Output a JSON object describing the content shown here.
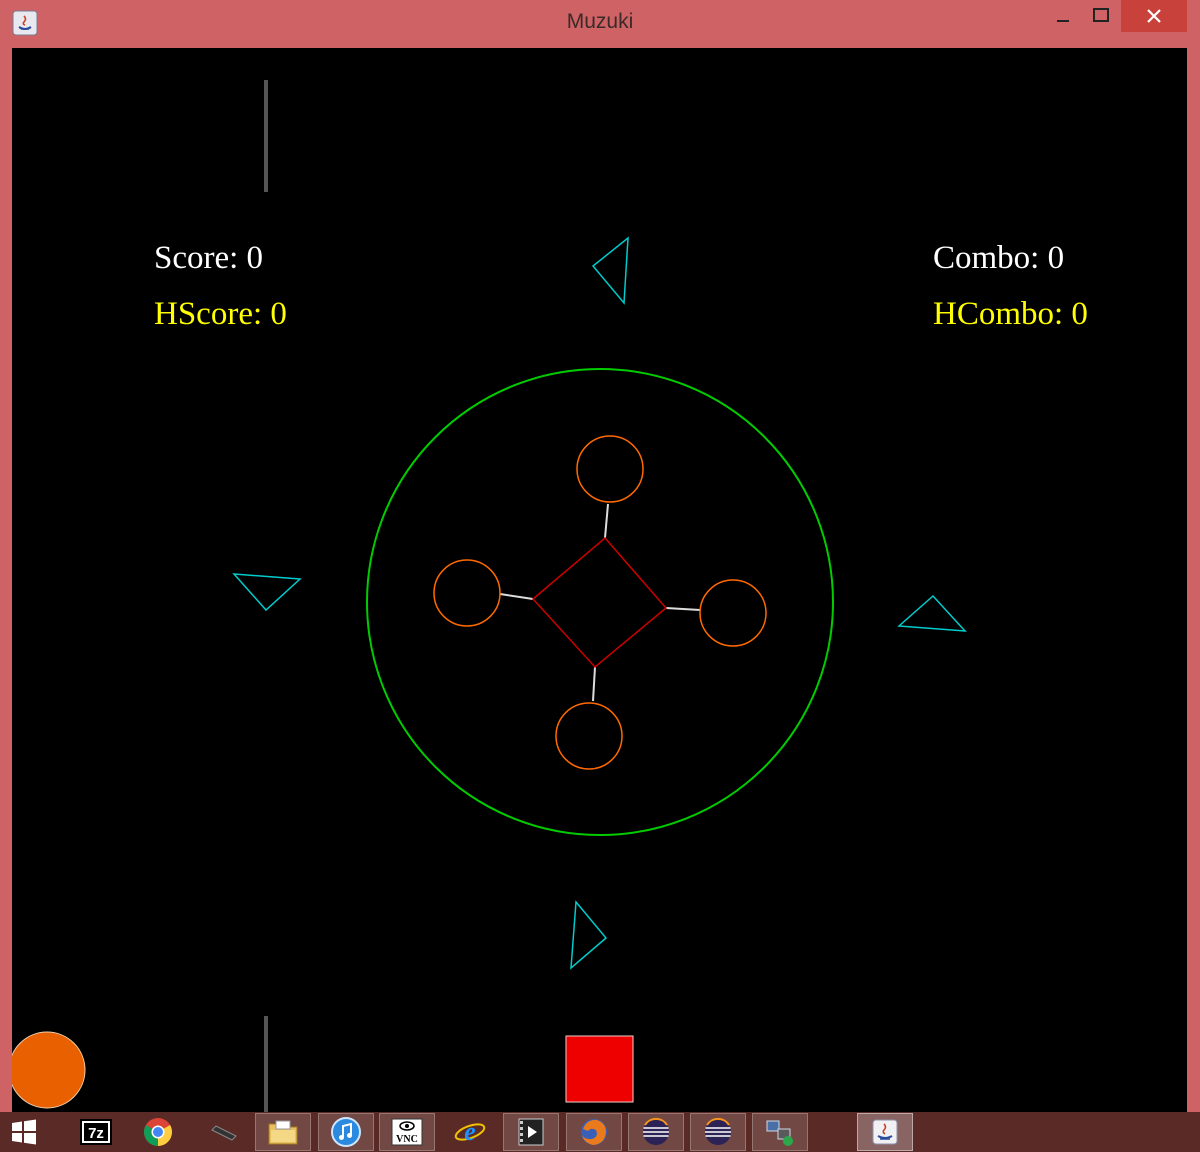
{
  "window": {
    "title": "Muzuki"
  },
  "hud": {
    "score_label": "Score: 0",
    "highscore_label": "HScore: 0",
    "combo_label": "Combo: 0",
    "highcombo_label": "HCombo: 0"
  },
  "stats": {
    "score": 0,
    "high_score": 0,
    "combo": 0,
    "high_combo": 0
  },
  "colors": {
    "background": "#000000",
    "hud_text": "#ffffff",
    "hud_highlight": "#ffff00",
    "ring": "#00cc00",
    "pads": "#ff6a00",
    "center_diamond": "#cc0000",
    "arrows": "#00cccc",
    "lane_bars": "#555555",
    "player_orb": "#e86000",
    "note_block": "#ee0000",
    "titlebar": "#cf6264",
    "taskbar": "#5a2a26"
  },
  "taskbar": {
    "items": [
      {
        "name": "start-icon"
      },
      {
        "name": "7zip-icon",
        "label": "7z"
      },
      {
        "name": "chrome-icon"
      },
      {
        "name": "pen-icon"
      },
      {
        "name": "file-explorer-icon"
      },
      {
        "name": "itunes-icon"
      },
      {
        "name": "vnc-icon",
        "label": "VNC"
      },
      {
        "name": "internet-explorer-icon"
      },
      {
        "name": "media-player-icon"
      },
      {
        "name": "firefox-icon"
      },
      {
        "name": "eclipse-icon"
      },
      {
        "name": "eclipse-icon-2"
      },
      {
        "name": "network-icon"
      },
      {
        "name": "java-icon"
      }
    ]
  }
}
